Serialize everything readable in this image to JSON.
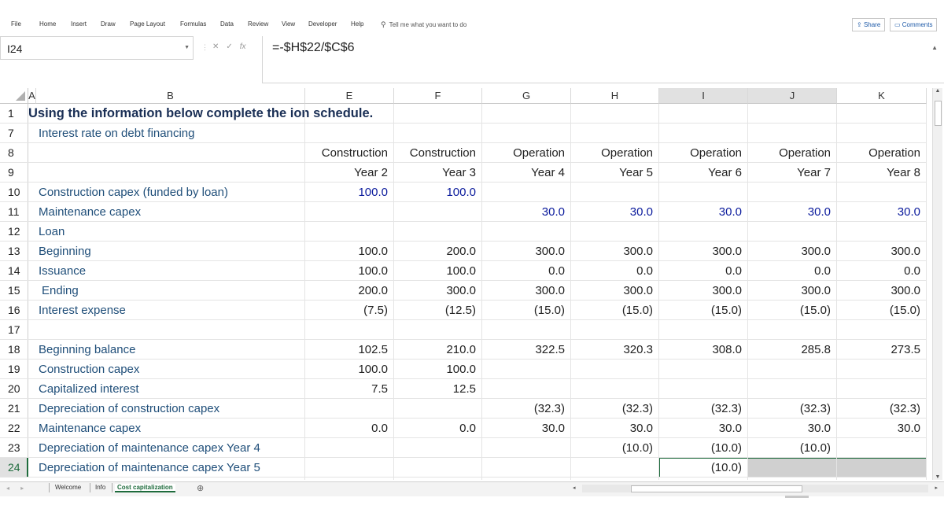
{
  "ribbon": {
    "tabs": [
      "File",
      "Home",
      "Insert",
      "Draw",
      "Page Layout",
      "Formulas",
      "Data",
      "Review",
      "View",
      "Developer",
      "Help"
    ],
    "tell_me": "Tell me what you want to do",
    "share": "Share",
    "comments": "Comments"
  },
  "formula_bar": {
    "name_box": "I24",
    "formula": "=-$H$22/$C$6"
  },
  "columns": [
    "A",
    "B",
    "E",
    "F",
    "G",
    "H",
    "I",
    "J",
    "K"
  ],
  "rows": [
    {
      "num": "1",
      "label": "Using the information below complete the ion schedule.",
      "style": "title",
      "values": [
        "",
        "",
        "",
        "",
        "",
        "",
        ""
      ]
    },
    {
      "num": "7",
      "label": "Interest rate on debt financing",
      "values": [
        "",
        "",
        "",
        "",
        "",
        "",
        ""
      ]
    },
    {
      "num": "8",
      "label": "",
      "values": [
        "Construction",
        "Construction",
        "Operation",
        "Operation",
        "Operation",
        "Operation",
        "Operation"
      ]
    },
    {
      "num": "9",
      "label": "",
      "values": [
        "Year 2",
        "Year 3",
        "Year 4",
        "Year 5",
        "Year 6",
        "Year 7",
        "Year 8"
      ]
    },
    {
      "num": "10",
      "label": "Construction capex (funded by loan)",
      "values": [
        "100.0",
        "100.0",
        "",
        "",
        "",
        "",
        ""
      ],
      "blue": [
        true,
        true,
        false,
        false,
        false,
        false,
        false
      ]
    },
    {
      "num": "11",
      "label": "Maintenance capex",
      "values": [
        "",
        "",
        "30.0",
        "30.0",
        "30.0",
        "30.0",
        "30.0"
      ],
      "blue": [
        false,
        false,
        true,
        true,
        true,
        true,
        true
      ]
    },
    {
      "num": "12",
      "label": "Loan",
      "values": [
        "",
        "",
        "",
        "",
        "",
        "",
        ""
      ]
    },
    {
      "num": "13",
      "label": "Beginning",
      "values": [
        "100.0",
        "200.0",
        "300.0",
        "300.0",
        "300.0",
        "300.0",
        "300.0"
      ]
    },
    {
      "num": "14",
      "label": "Issuance",
      "values": [
        "100.0",
        "100.0",
        "0.0",
        "0.0",
        "0.0",
        "0.0",
        "0.0"
      ]
    },
    {
      "num": "15",
      "label": "Ending",
      "style": "indent",
      "values": [
        "200.0",
        "300.0",
        "300.0",
        "300.0",
        "300.0",
        "300.0",
        "300.0"
      ]
    },
    {
      "num": "16",
      "label": "Interest expense",
      "values": [
        "(7.5)",
        "(12.5)",
        "(15.0)",
        "(15.0)",
        "(15.0)",
        "(15.0)",
        "(15.0)"
      ]
    },
    {
      "num": "17",
      "label": "",
      "values": [
        "",
        "",
        "",
        "",
        "",
        "",
        ""
      ]
    },
    {
      "num": "18",
      "label": "Beginning balance",
      "values": [
        "102.5",
        "210.0",
        "322.5",
        "320.3",
        "308.0",
        "285.8",
        "273.5"
      ]
    },
    {
      "num": "19",
      "label": "Construction capex",
      "values": [
        "100.0",
        "100.0",
        "",
        "",
        "",
        "",
        ""
      ]
    },
    {
      "num": "20",
      "label": "Capitalized interest",
      "values": [
        "7.5",
        "12.5",
        "",
        "",
        "",
        "",
        ""
      ]
    },
    {
      "num": "21",
      "label": "Depreciation of construction capex",
      "values": [
        "",
        "",
        "(32.3)",
        "(32.3)",
        "(32.3)",
        "(32.3)",
        "(32.3)"
      ]
    },
    {
      "num": "22",
      "label": "Maintenance capex",
      "values": [
        "0.0",
        "0.0",
        "30.0",
        "30.0",
        "30.0",
        "30.0",
        "30.0"
      ]
    },
    {
      "num": "23",
      "label": "Depreciation of maintenance capex Year 4",
      "values": [
        "",
        "",
        "",
        "(10.0)",
        "(10.0)",
        "(10.0)",
        ""
      ]
    },
    {
      "num": "24",
      "label": "Depreciation of maintenance capex Year 5",
      "values": [
        "",
        "",
        "",
        "",
        "(10.0)",
        "",
        ""
      ]
    }
  ],
  "sheets": {
    "tabs": [
      "Welcome",
      "Info",
      "Cost capitalization"
    ],
    "active": "Cost capitalization"
  }
}
